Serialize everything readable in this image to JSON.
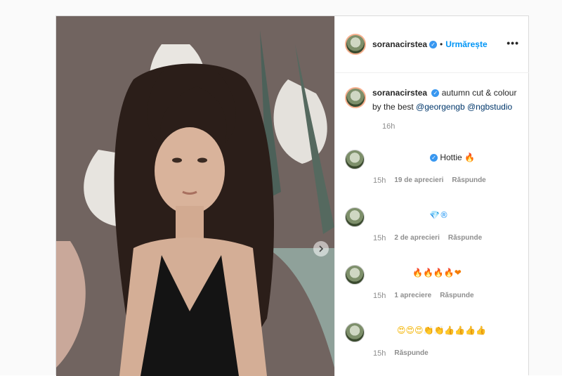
{
  "post": {
    "username": "soranacirstea",
    "follow_label": "Urmărește",
    "more_icon": "•••",
    "caption": {
      "text": "autumn cut & colour by the best ",
      "mention1": "@georgengb",
      "mention2": "@ngbstudio",
      "time": "16h"
    }
  },
  "comments": [
    {
      "text": "Hottie",
      "emoji": "🔥",
      "time": "15h",
      "likes": "19 de aprecieri",
      "reply": "Răspunde"
    },
    {
      "text": "",
      "emoji": "💎®",
      "time": "15h",
      "likes": "2 de aprecieri",
      "reply": "Răspunde"
    },
    {
      "text": "",
      "emoji": "🔥🔥🔥🔥❤",
      "time": "15h",
      "likes": "1 apreciere",
      "reply": "Răspunde"
    },
    {
      "text": "",
      "emoji": "😍😍😍👏👏👍👍👍👍",
      "time": "15h",
      "likes": "",
      "reply": "Răspunde"
    }
  ]
}
